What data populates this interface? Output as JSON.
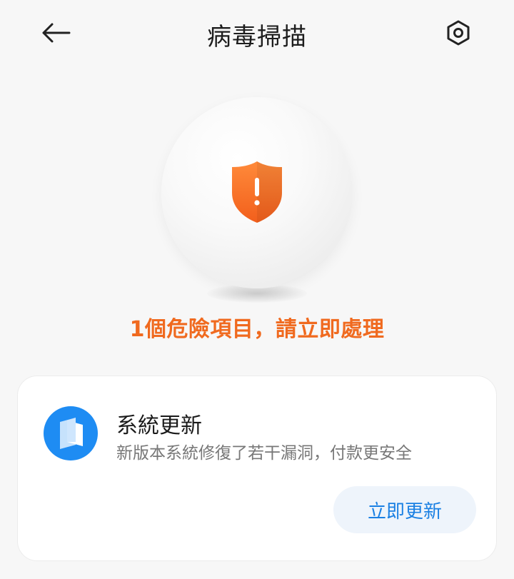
{
  "header": {
    "title": "病毒掃描",
    "back_icon": "arrow-left-icon",
    "settings_icon": "settings-hexagon-icon"
  },
  "status": {
    "icon": "shield-warning-icon",
    "message": "1個危險項目，請立即處理",
    "color": "#f06a1f"
  },
  "card": {
    "app_icon": "system-update-icon",
    "title": "系統更新",
    "description": "新版本系統修復了若干漏洞，付款更安全",
    "button_label": "立即更新",
    "accent": "#1a80e3"
  }
}
